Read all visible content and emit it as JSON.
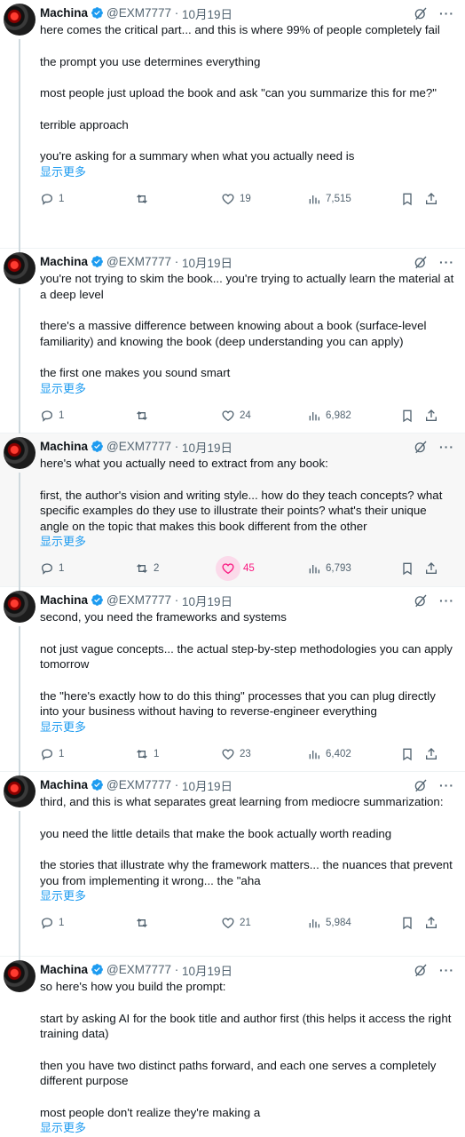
{
  "tweets": [
    {
      "name": "Machina",
      "handle": "@EXM7777",
      "date": "10月19日",
      "paragraphs": [
        "here comes the critical part... and this is where 99% of people completely fail",
        "the prompt you use determines everything",
        "most people just upload the book and ask \"can you summarize this for me?\"",
        "terrible approach",
        "you're asking for a summary when what you actually need is"
      ],
      "show_more": "显示更多",
      "replies": "1",
      "retweets": "",
      "likes": "19",
      "views": "7,515",
      "liked": false
    },
    {
      "name": "Machina",
      "handle": "@EXM7777",
      "date": "10月19日",
      "paragraphs": [
        "you're not trying to skim the book... you're trying to actually learn the material at a deep level",
        "there's a massive difference between knowing about a book (surface-level familiarity) and knowing the book (deep understanding you can apply)",
        "the first one makes you sound smart"
      ],
      "show_more": "显示更多",
      "replies": "1",
      "retweets": "",
      "likes": "24",
      "views": "6,982",
      "liked": false
    },
    {
      "name": "Machina",
      "handle": "@EXM7777",
      "date": "10月19日",
      "paragraphs": [
        "here's what you actually need to extract from any book:",
        "first, the author's vision and writing style... how do they teach concepts? what specific examples do they use to illustrate their points? what's their unique angle on the topic that makes this book different from the other"
      ],
      "show_more": "显示更多",
      "replies": "1",
      "retweets": "2",
      "likes": "45",
      "views": "6,793",
      "liked": true
    },
    {
      "name": "Machina",
      "handle": "@EXM7777",
      "date": "10月19日",
      "paragraphs": [
        "second, you need the frameworks and systems",
        "not just vague concepts... the actual step-by-step methodologies you can apply tomorrow",
        "the \"here's exactly how to do this thing\" processes that you can plug directly into your business without having to reverse-engineer everything"
      ],
      "show_more": "显示更多",
      "replies": "1",
      "retweets": "1",
      "likes": "23",
      "views": "6,402",
      "liked": false
    },
    {
      "name": "Machina",
      "handle": "@EXM7777",
      "date": "10月19日",
      "paragraphs": [
        "third, and this is what separates great learning from mediocre summarization:",
        "you need the little details that make the book actually worth reading",
        "the stories that illustrate why the framework matters... the nuances that prevent you from implementing it wrong... the \"aha"
      ],
      "show_more": "显示更多",
      "replies": "1",
      "retweets": "",
      "likes": "21",
      "views": "5,984",
      "liked": false
    },
    {
      "name": "Machina",
      "handle": "@EXM7777",
      "date": "10月19日",
      "paragraphs": [
        "so here's how you build the prompt:",
        "start by asking AI for the book title and author first (this helps it access the right training data)",
        "then you have two distinct paths forward, and each one serves a completely different purpose",
        "most people don't realize they're making a"
      ],
      "show_more": "显示更多",
      "replies": "",
      "retweets": "",
      "likes": "",
      "views": "",
      "liked": false
    }
  ],
  "icons": {
    "verified": "verified-badge-icon",
    "grok": "grok-icon",
    "more": "more-options-icon",
    "reply": "reply-icon",
    "retweet": "retweet-icon",
    "like": "like-heart-icon",
    "views": "views-bar-chart-icon",
    "bookmark": "bookmark-icon",
    "share": "share-icon"
  },
  "colors": {
    "accent": "#1d9bf0",
    "like_active": "#f91880",
    "muted": "#536471"
  }
}
